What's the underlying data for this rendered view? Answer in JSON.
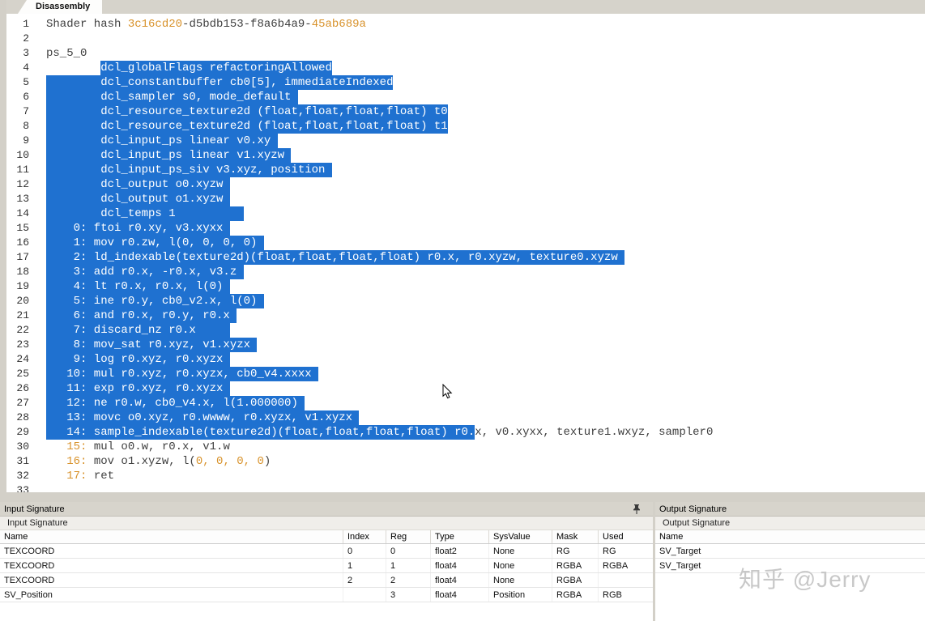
{
  "tab": {
    "label": "Disassembly"
  },
  "editor": {
    "lines": [
      {
        "n": "1",
        "segs": [
          {
            "t": "Shader hash ",
            "c": "n"
          },
          {
            "t": "3c16cd20",
            "c": "o"
          },
          {
            "t": "-d5bdb153-f8a6b4a9-",
            "c": "n"
          },
          {
            "t": "45ab689a",
            "c": "o"
          }
        ]
      },
      {
        "n": "2",
        "segs": []
      },
      {
        "n": "3",
        "segs": [
          {
            "t": "ps_5_0",
            "c": "n"
          }
        ]
      },
      {
        "n": "4",
        "segs": [
          {
            "t": "        ",
            "c": "n"
          },
          {
            "t": "dcl_globalFlags refactoringAllowed",
            "c": "n",
            "sel": true
          }
        ]
      },
      {
        "n": "5",
        "segs": [
          {
            "t": "        dcl_constantbuffer cb0[5], immediateIndexed",
            "c": "n",
            "sel": true
          }
        ]
      },
      {
        "n": "6",
        "segs": [
          {
            "t": "        dcl_sampler s0, mode_default ",
            "c": "n",
            "sel": true
          }
        ]
      },
      {
        "n": "7",
        "segs": [
          {
            "t": "        dcl_resource_texture2d (float,float,float,float) t0",
            "c": "n",
            "sel": true
          }
        ]
      },
      {
        "n": "8",
        "segs": [
          {
            "t": "        dcl_resource_texture2d (float,float,float,float) t1",
            "c": "n",
            "sel": true
          }
        ]
      },
      {
        "n": "9",
        "segs": [
          {
            "t": "        dcl_input_ps linear v0.xy ",
            "c": "n",
            "sel": true
          }
        ]
      },
      {
        "n": "10",
        "segs": [
          {
            "t": "        dcl_input_ps linear v1.xyzw ",
            "c": "n",
            "sel": true
          }
        ]
      },
      {
        "n": "11",
        "segs": [
          {
            "t": "        dcl_input_ps_siv v3.xyz, position ",
            "c": "n",
            "sel": true
          }
        ]
      },
      {
        "n": "12",
        "segs": [
          {
            "t": "        dcl_output o0.xyzw ",
            "c": "n",
            "sel": true
          }
        ]
      },
      {
        "n": "13",
        "segs": [
          {
            "t": "        dcl_output o1.xyzw ",
            "c": "n",
            "sel": true
          }
        ]
      },
      {
        "n": "14",
        "segs": [
          {
            "t": "        dcl_temps 1          ",
            "c": "n",
            "sel": true
          }
        ]
      },
      {
        "n": "15",
        "segs": [
          {
            "t": "    0: ftoi r0.xy, v3.xyxx ",
            "c": "n",
            "sel": true
          }
        ]
      },
      {
        "n": "16",
        "segs": [
          {
            "t": "    1: mov r0.zw, l(0, 0, 0, 0) ",
            "c": "n",
            "sel": true
          }
        ]
      },
      {
        "n": "17",
        "segs": [
          {
            "t": "    2: ld_indexable(texture2d)(float,float,float,float) r0.x, r0.xyzw, texture0.xyzw ",
            "c": "n",
            "sel": true
          }
        ]
      },
      {
        "n": "18",
        "segs": [
          {
            "t": "    3: add r0.x, -r0.x, v3.z ",
            "c": "n",
            "sel": true
          }
        ]
      },
      {
        "n": "19",
        "segs": [
          {
            "t": "    4: lt r0.x, r0.x, l(0) ",
            "c": "n",
            "sel": true
          }
        ]
      },
      {
        "n": "20",
        "segs": [
          {
            "t": "    5: ine r0.y, cb0_v2.x, l(0) ",
            "c": "n",
            "sel": true
          }
        ]
      },
      {
        "n": "21",
        "segs": [
          {
            "t": "    6: and r0.x, r0.y, r0.x ",
            "c": "n",
            "sel": true
          }
        ]
      },
      {
        "n": "22",
        "segs": [
          {
            "t": "    7: discard_nz r0.x     ",
            "c": "n",
            "sel": true
          }
        ]
      },
      {
        "n": "23",
        "segs": [
          {
            "t": "    8: mov_sat r0.xyz, v1.xyzx ",
            "c": "n",
            "sel": true
          }
        ]
      },
      {
        "n": "24",
        "segs": [
          {
            "t": "    9: log r0.xyz, r0.xyzx ",
            "c": "n",
            "sel": true
          }
        ]
      },
      {
        "n": "25",
        "segs": [
          {
            "t": "   10: mul r0.xyz, r0.xyzx, cb0_v4.xxxx ",
            "c": "n",
            "sel": true
          }
        ]
      },
      {
        "n": "26",
        "segs": [
          {
            "t": "   11: exp r0.xyz, r0.xyzx ",
            "c": "n",
            "sel": true
          }
        ]
      },
      {
        "n": "27",
        "segs": [
          {
            "t": "   12: ne r0.w, cb0_v4.x, l(1.000000) ",
            "c": "n",
            "sel": true
          }
        ]
      },
      {
        "n": "28",
        "segs": [
          {
            "t": "   13: movc o0.xyz, r0.wwww, r0.xyzx, v1.xyzx ",
            "c": "n",
            "sel": true
          }
        ]
      },
      {
        "n": "29",
        "segs": [
          {
            "t": "   14: sample_indexable(texture2d)(float,float,float,float) r0.",
            "c": "n",
            "sel": true
          },
          {
            "t": "x, v0.xyxx, texture1.wxyz, sampler0",
            "c": "n"
          }
        ]
      },
      {
        "n": "30",
        "segs": [
          {
            "t": "   15: ",
            "c": "o"
          },
          {
            "t": "mul o0.w, r0.x, v1.w",
            "c": "n"
          }
        ]
      },
      {
        "n": "31",
        "segs": [
          {
            "t": "   16: ",
            "c": "o"
          },
          {
            "t": "mov o1.xyzw, l(",
            "c": "n"
          },
          {
            "t": "0, 0, 0, 0",
            "c": "o"
          },
          {
            "t": ")",
            "c": "n"
          }
        ]
      },
      {
        "n": "32",
        "segs": [
          {
            "t": "   17: ",
            "c": "o"
          },
          {
            "t": "ret",
            "c": "n"
          }
        ]
      },
      {
        "n": "33",
        "segs": []
      }
    ]
  },
  "input_signature": {
    "title": "Input Signature",
    "toolbar_label": "Input Signature",
    "columns": [
      "Name",
      "Index",
      "Reg",
      "Type",
      "SysValue",
      "Mask",
      "Used"
    ],
    "rows": [
      [
        "TEXCOORD",
        "0",
        "0",
        "float2",
        "None",
        "RG",
        "RG"
      ],
      [
        "TEXCOORD",
        "1",
        "1",
        "float4",
        "None",
        "RGBA",
        "RGBA"
      ],
      [
        "TEXCOORD",
        "2",
        "2",
        "float4",
        "None",
        "RGBA",
        ""
      ],
      [
        "SV_Position",
        "",
        "3",
        "float4",
        "Position",
        "RGBA",
        "RGB"
      ]
    ]
  },
  "output_signature": {
    "title": "Output Signature",
    "toolbar_label": "Output Signature",
    "columns": [
      "Name"
    ],
    "rows": [
      [
        "SV_Target"
      ],
      [
        "SV_Target"
      ]
    ]
  },
  "watermark": "知乎 @Jerry",
  "colors": {
    "selection": "#1f71d0",
    "literal_orange": "#d8922b",
    "code_text": "#3f3f3f"
  }
}
